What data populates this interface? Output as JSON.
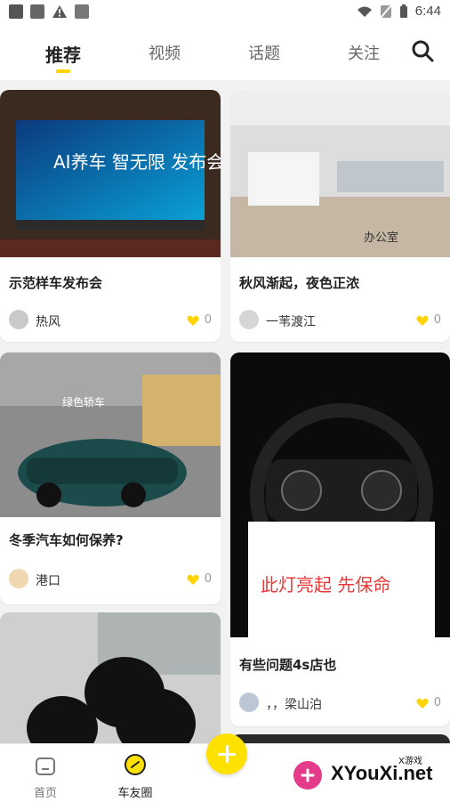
{
  "status": {
    "time": "6:44"
  },
  "tabs": [
    {
      "label": "推荐",
      "active": true
    },
    {
      "label": "视频",
      "active": false
    },
    {
      "label": "话题",
      "active": false
    },
    {
      "label": "关注",
      "active": false
    }
  ],
  "cards": [
    {
      "title": "示范样车发布会",
      "author": "热风",
      "likes": "0",
      "image": "AI养车 智无限 发布会 屏幕"
    },
    {
      "title": "秋风渐起，夜色正浓",
      "author": "一苇渡江",
      "likes": "0",
      "image": "办公室"
    },
    {
      "title": "冬季汽车如何保养?",
      "author": "港口",
      "likes": "0",
      "image": "绿色轿车"
    },
    {
      "title": "有些问题4s店也",
      "author": "，，梁山泊",
      "likes": "0",
      "image": "此灯亮起 先保命"
    },
    {
      "title": "",
      "author": "",
      "likes": "",
      "image": "轮胎"
    }
  ],
  "bottom_nav": [
    {
      "label": "首页"
    },
    {
      "label": "车友圈"
    }
  ],
  "watermark": {
    "text": "XYouXi.net",
    "sub": "X游戏"
  },
  "colors": {
    "accent": "#ffd400",
    "fab": "#ffe100"
  }
}
